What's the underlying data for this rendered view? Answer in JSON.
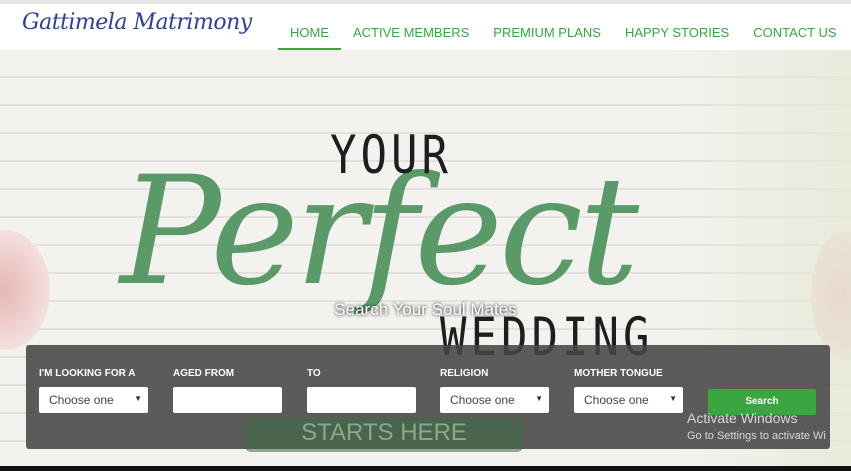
{
  "header": {
    "logo": "Gattimela Matrimony",
    "nav": [
      "HOME",
      "ACTIVE MEMBERS",
      "PREMIUM PLANS",
      "HAPPY STORIES",
      "CONTACT US"
    ],
    "active": "HOME"
  },
  "hero": {
    "your": "YOUR",
    "perfect": "Perfect",
    "wedding": "WEDDING",
    "subtitle": "Search Your Soul Mates",
    "starts": "STARTS HERE"
  },
  "search": {
    "looking_label": "I'M LOOKING FOR A",
    "looking_value": "Choose one",
    "aged_from_label": "AGED FROM",
    "aged_from_value": "",
    "to_label": "TO",
    "to_value": "",
    "religion_label": "RELIGION",
    "religion_value": "Choose one",
    "tongue_label": "MOTHER TONGUE",
    "tongue_value": "Choose one",
    "button": "Search"
  },
  "watermark": {
    "title": "Activate Windows",
    "subtitle": "Go to Settings to activate Wi"
  },
  "colors": {
    "accent": "#3aa541",
    "logo": "#2b3f9e"
  }
}
